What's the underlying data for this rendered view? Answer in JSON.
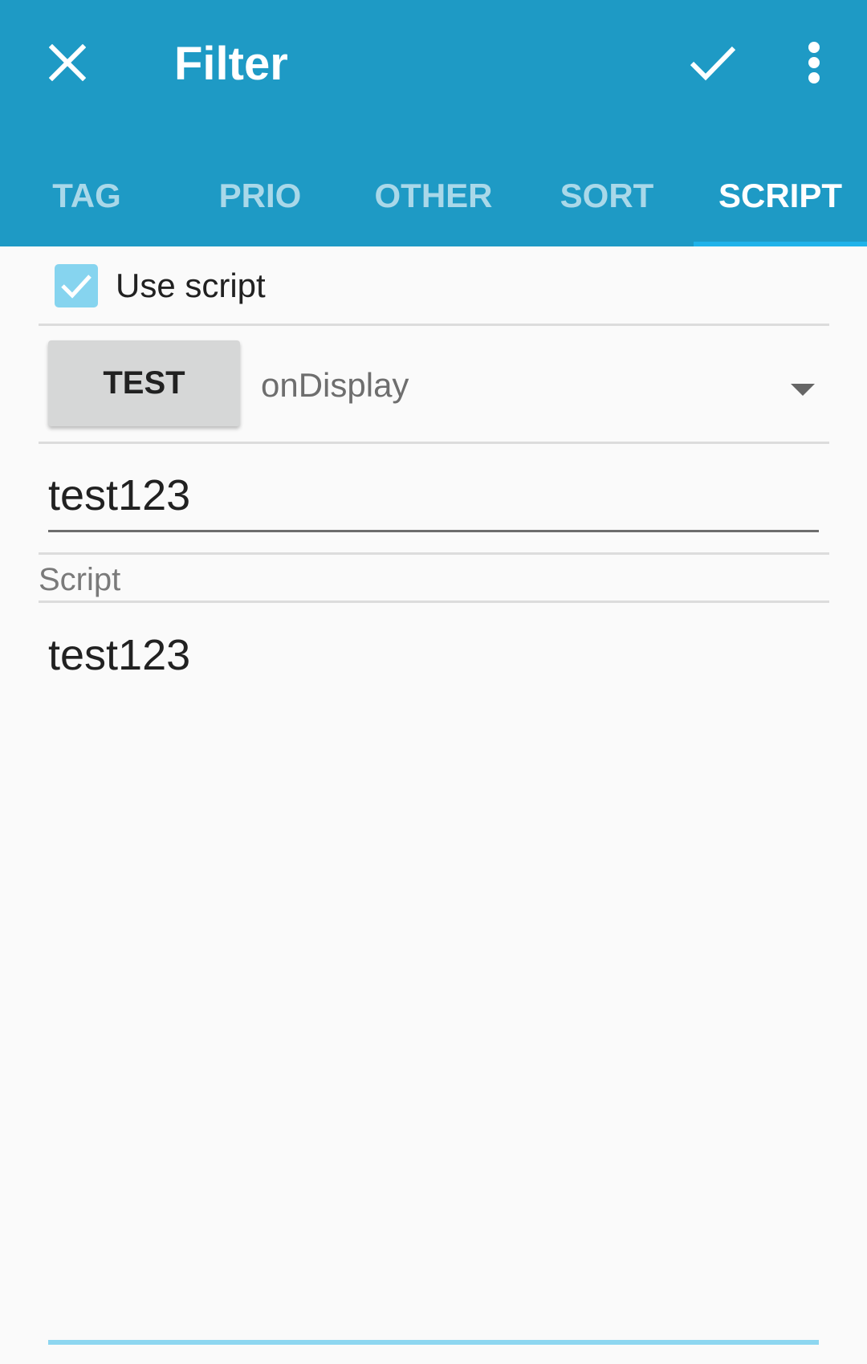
{
  "toolbar": {
    "close_icon": "close-icon",
    "title": "Filter",
    "confirm_icon": "check-icon",
    "overflow_icon": "more-vert-icon"
  },
  "tabs": [
    {
      "label": "TAG"
    },
    {
      "label": "PRIO"
    },
    {
      "label": "OTHER"
    },
    {
      "label": "SORT"
    },
    {
      "label": "SCRIPT",
      "active": true
    }
  ],
  "use_script": {
    "checked": true,
    "label": "Use script"
  },
  "test_button": {
    "label": "TEST"
  },
  "event_select": {
    "value": "onDisplay"
  },
  "name_field": {
    "value": "test123"
  },
  "script_section": {
    "label": "Script",
    "content": "test123"
  },
  "colors": {
    "appbar": "#1e9ac5",
    "tab_indicator": "#20b3ea",
    "checkbox": "#86d4ef",
    "background": "#fafafa"
  }
}
